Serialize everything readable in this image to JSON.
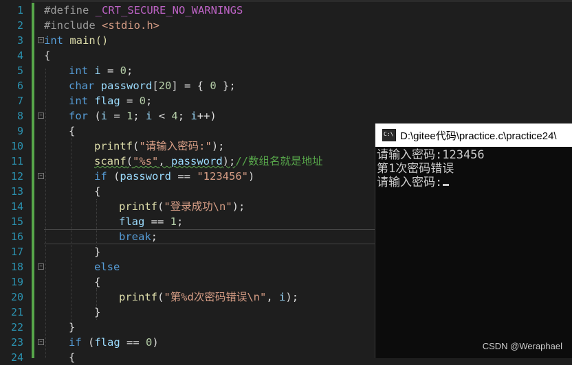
{
  "editor": {
    "line_numbers": [
      "1",
      "2",
      "3",
      "4",
      "5",
      "6",
      "7",
      "8",
      "9",
      "10",
      "11",
      "12",
      "13",
      "14",
      "15",
      "16",
      "17",
      "18",
      "19",
      "20",
      "21",
      "22",
      "23",
      "24"
    ],
    "code": {
      "l1_directive": "#define",
      "l1_macro": "_CRT_SECURE_NO_WARNINGS",
      "l2_directive": "#include",
      "l2_header": "<stdio.h>",
      "l3_kw": "int",
      "l3_rest": " main()",
      "l4": "{",
      "l5_kw": "int",
      "l5_var": " i",
      "l5_op": " = ",
      "l5_num": "0",
      "l5_end": ";",
      "l6_kw": "char",
      "l6_var": " password",
      "l6_b1": "[",
      "l6_num": "20",
      "l6_b2": "] = { ",
      "l6_num2": "0",
      "l6_end": " };",
      "l7_kw": "int",
      "l7_var": " flag",
      "l7_op": " = ",
      "l7_num": "0",
      "l7_end": ";",
      "l8_kw": "for",
      "l8_a": " (",
      "l8_i1": "i",
      "l8_b": " = ",
      "l8_n1": "1",
      "l8_c": "; ",
      "l8_i2": "i",
      "l8_d": " < ",
      "l8_n2": "4",
      "l8_e": "; ",
      "l8_i3": "i",
      "l8_f": "++)",
      "l9": "{",
      "l10_fn": "printf",
      "l10_a": "(",
      "l10_str": "\"请输入密码:\"",
      "l10_end": ");",
      "l11_fn": "scanf",
      "l11_a": "(",
      "l11_str": "\"%s\"",
      "l11_b": ", ",
      "l11_var": "password",
      "l11_end": ");",
      "l11_cmt": "//数组名就是地址",
      "l12_kw": "if",
      "l12_a": " (",
      "l12_var": "password",
      "l12_b": " == ",
      "l12_str": "\"123456\"",
      "l12_end": ")",
      "l13": "{",
      "l14_fn": "printf",
      "l14_a": "(",
      "l14_str": "\"登录成功\\n\"",
      "l14_end": ");",
      "l15_var": "flag",
      "l15_op": " == ",
      "l15_num": "1",
      "l15_end": ";",
      "l16_kw": "break",
      "l16_end": ";",
      "l17": "}",
      "l18_kw": "else",
      "l19": "{",
      "l20_fn": "printf",
      "l20_a": "(",
      "l20_str": "\"第%d次密码错误\\n\"",
      "l20_b": ", ",
      "l20_var": "i",
      "l20_end": ");",
      "l21": "}",
      "l22": "}",
      "l23_kw": "if",
      "l23_a": " (",
      "l23_var": "flag",
      "l23_b": " == ",
      "l23_num": "0",
      "l23_end": ")",
      "l24": "{"
    }
  },
  "console": {
    "title": "D:\\gitee代码\\practice.c\\practice24\\",
    "icon": "cmd-icon",
    "icon_text": "C:\\",
    "lines": [
      "请输入密码:123456",
      "第1次密码错误",
      "请输入密码:"
    ]
  },
  "watermark": "CSDN @Weraphael",
  "colors": {
    "background": "#1e1e1e",
    "keyword": "#569cd6",
    "string": "#d69d85",
    "comment": "#57a64a",
    "line_number": "#2b91af",
    "console_bg": "#0c0c0c"
  }
}
